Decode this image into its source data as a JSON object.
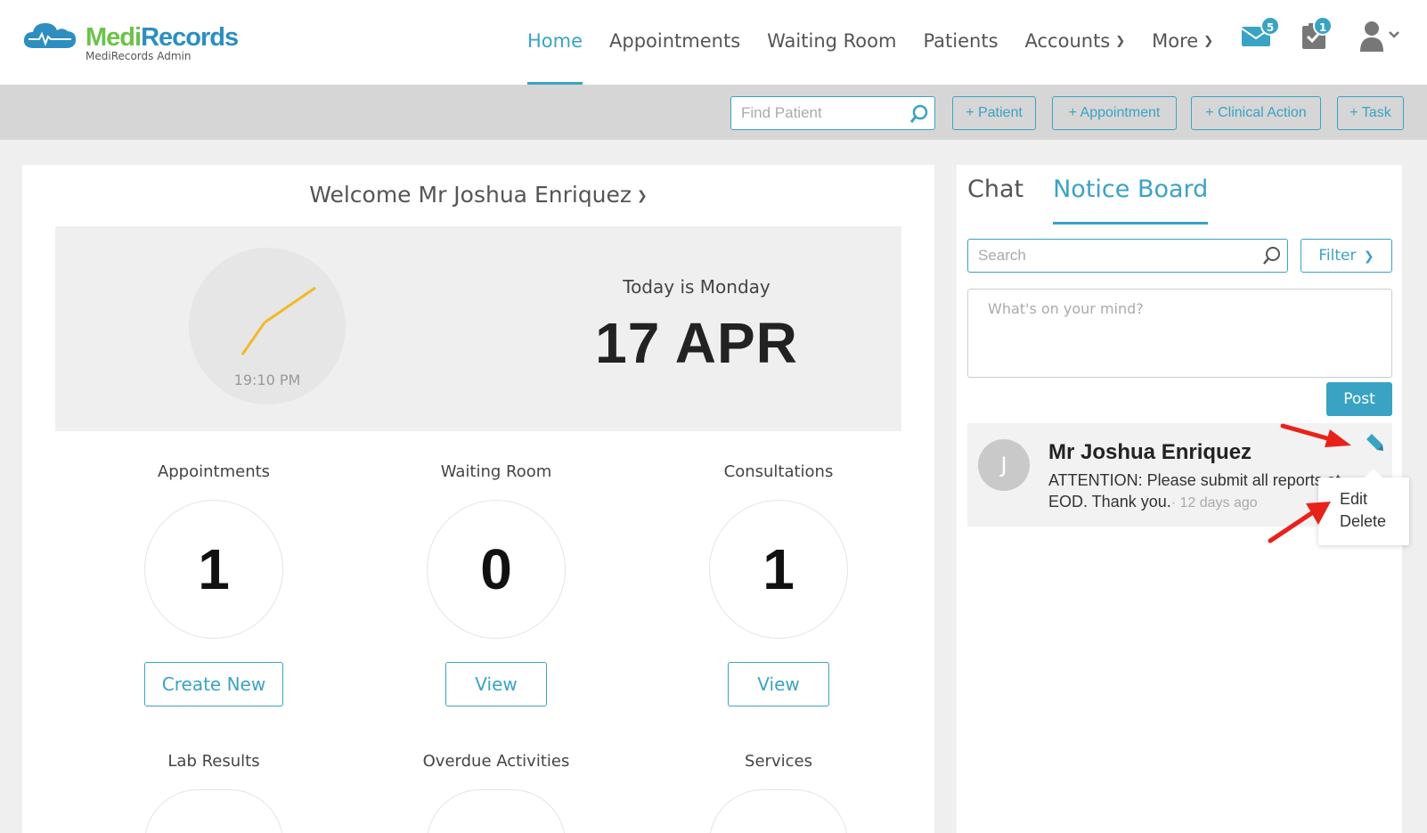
{
  "app": {
    "logo_medi": "Medi",
    "logo_records": "Records",
    "logo_subtitle": "MediRecords Admin"
  },
  "nav": {
    "items": [
      {
        "label": "Home",
        "active": true
      },
      {
        "label": "Appointments"
      },
      {
        "label": "Waiting Room"
      },
      {
        "label": "Patients"
      },
      {
        "label": "Accounts",
        "dropdown": true
      },
      {
        "label": "More",
        "dropdown": true
      }
    ],
    "messages_badge": "5",
    "tasks_badge": "1",
    "messages_icon": "envelope-icon",
    "tasks_icon": "clipboard-check-icon",
    "user_icon": "user-icon"
  },
  "toolbar": {
    "find_patient_placeholder": "Find Patient",
    "buttons": [
      "+ Patient",
      "+ Appointment",
      "+ Clinical Action",
      "+ Task"
    ]
  },
  "dashboard": {
    "welcome": "Welcome Mr Joshua Enriquez",
    "clock_time": "19:10 PM",
    "today_label": "Today is Monday",
    "date": "17 APR",
    "stats": [
      {
        "label": "Appointments",
        "value": "1",
        "button": "Create New"
      },
      {
        "label": "Waiting Room",
        "value": "0",
        "button": "View"
      },
      {
        "label": "Consultations",
        "value": "1",
        "button": "View"
      },
      {
        "label": "Lab Results"
      },
      {
        "label": "Overdue Activities"
      },
      {
        "label": "Services"
      }
    ]
  },
  "side": {
    "tabs": [
      {
        "label": "Chat"
      },
      {
        "label": "Notice Board",
        "active": true
      }
    ],
    "search_placeholder": "Search",
    "filter_label": "Filter",
    "mind_placeholder": "What's on your mind?",
    "post_label": "Post",
    "notice": {
      "avatar_initial": "J",
      "author": "Mr Joshua Enriquez",
      "text": "ATTENTION: Please submit all reports at EOD. Thank you.",
      "time": "· 12 days ago"
    },
    "menu": [
      "Edit",
      "Delete"
    ]
  },
  "colors": {
    "accent": "#3aa3c4",
    "logo_green": "#6cc24a",
    "logo_blue": "#2d8ec2",
    "clock_hand": "#f2b929",
    "annotation_arrow": "#e8221b"
  }
}
